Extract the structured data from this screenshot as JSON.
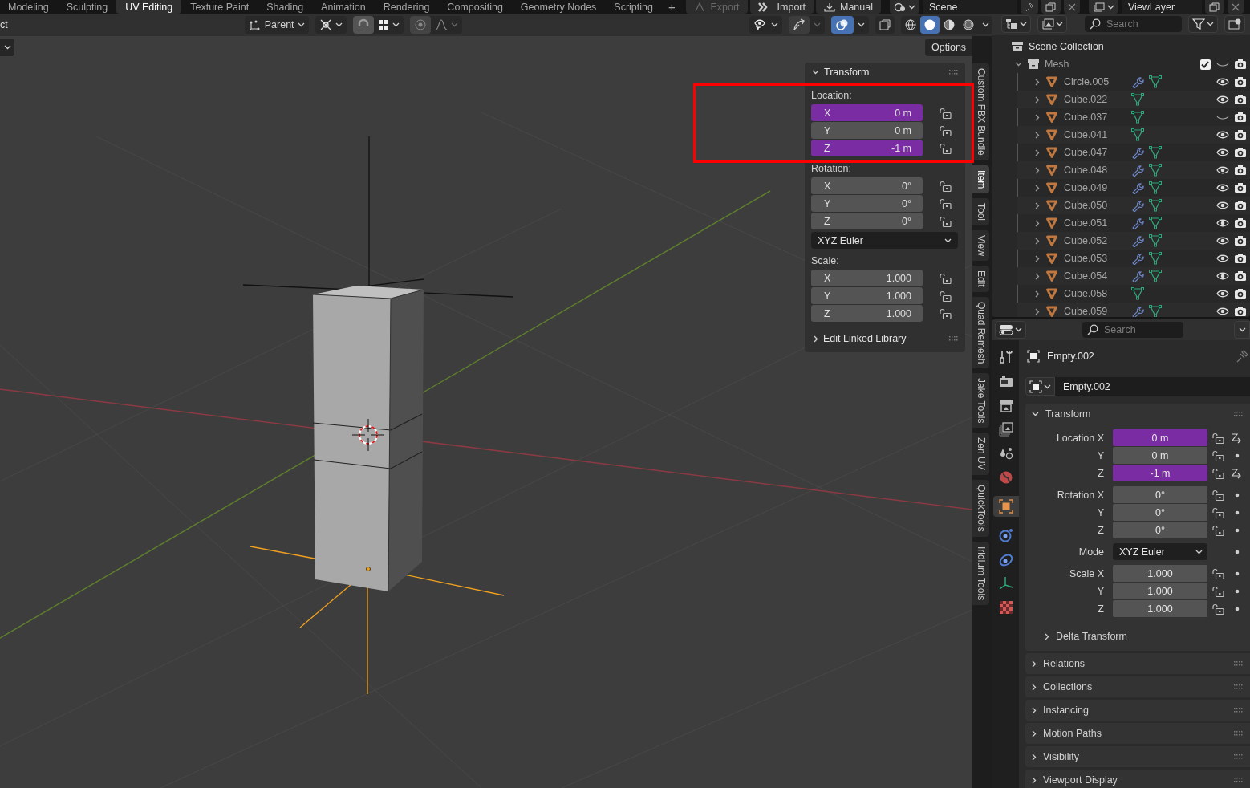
{
  "workspace_tabs": [
    {
      "label": "Modeling",
      "selected": false
    },
    {
      "label": "Sculpting",
      "selected": false
    },
    {
      "label": "UV Editing",
      "selected": true
    },
    {
      "label": "Texture Paint",
      "selected": false
    },
    {
      "label": "Shading",
      "selected": false
    },
    {
      "label": "Animation",
      "selected": false
    },
    {
      "label": "Rendering",
      "selected": false
    },
    {
      "label": "Compositing",
      "selected": false
    },
    {
      "label": "Geometry Nodes",
      "selected": false
    },
    {
      "label": "Scripting",
      "selected": false
    }
  ],
  "add_workspace": "+",
  "top_buttons": [
    {
      "label": "Export",
      "disabled": true
    },
    {
      "label": "Import",
      "disabled": false
    },
    {
      "label": "Manual",
      "disabled": false
    }
  ],
  "scene": "Scene",
  "view_layer": "ViewLayer",
  "viewport": {
    "mode_text": "ct",
    "pivot": "Parent",
    "options": "Options",
    "overlays_on": true,
    "shading_modes": [
      {
        "kind": "wireframe",
        "selected": false
      },
      {
        "kind": "solid",
        "selected": true
      },
      {
        "kind": "material",
        "selected": false
      },
      {
        "kind": "rendered",
        "selected": false
      }
    ]
  },
  "n_panel": {
    "title": "Transform",
    "location_label": "Location:",
    "location": [
      {
        "axis": "X",
        "value": "0 m",
        "keyed": true
      },
      {
        "axis": "Y",
        "value": "0 m",
        "keyed": false
      },
      {
        "axis": "Z",
        "value": "-1 m",
        "keyed": true
      }
    ],
    "rotation_label": "Rotation:",
    "rotation": [
      {
        "axis": "X",
        "value": "0°",
        "keyed": false
      },
      {
        "axis": "Y",
        "value": "0°",
        "keyed": false
      },
      {
        "axis": "Z",
        "value": "0°",
        "keyed": false
      }
    ],
    "rotation_mode": "XYZ Euler",
    "scale_label": "Scale:",
    "scale": [
      {
        "axis": "X",
        "value": "1.000",
        "keyed": false
      },
      {
        "axis": "Y",
        "value": "1.000",
        "keyed": false
      },
      {
        "axis": "Z",
        "value": "1.000",
        "keyed": false
      }
    ],
    "linked_library": "Edit Linked Library"
  },
  "sidebar_tabs": [
    {
      "label": "Custom FBX Bundle",
      "selected": false
    },
    {
      "label": "Item",
      "selected": true
    },
    {
      "label": "Tool",
      "selected": false
    },
    {
      "label": "View",
      "selected": false
    },
    {
      "label": "Edit",
      "selected": false
    },
    {
      "label": "Quad Remesh",
      "selected": false
    },
    {
      "label": "Jake Tools",
      "selected": false
    },
    {
      "label": "Zen UV",
      "selected": false
    },
    {
      "label": "QuickTools",
      "selected": false
    },
    {
      "label": "Iridium Tools",
      "selected": false
    }
  ],
  "outliner": {
    "search_placeholder": "Search",
    "root": "Scene Collection",
    "collections": [
      {
        "name": "Mesh",
        "expanded": true,
        "enabled": true,
        "visible": false,
        "children": [
          {
            "name": "Circle.005",
            "modifier": true,
            "visible": true
          },
          {
            "name": "Cube.022",
            "modifier": false,
            "visible": true
          },
          {
            "name": "Cube.037",
            "modifier": false,
            "visible": false
          },
          {
            "name": "Cube.041",
            "modifier": false,
            "visible": true
          },
          {
            "name": "Cube.047",
            "modifier": true,
            "visible": true
          },
          {
            "name": "Cube.048",
            "modifier": true,
            "visible": true
          },
          {
            "name": "Cube.049",
            "modifier": true,
            "visible": true
          },
          {
            "name": "Cube.050",
            "modifier": true,
            "visible": true
          },
          {
            "name": "Cube.051",
            "modifier": true,
            "visible": true
          },
          {
            "name": "Cube.052",
            "modifier": true,
            "visible": true
          },
          {
            "name": "Cube.053",
            "modifier": true,
            "visible": true
          },
          {
            "name": "Cube.054",
            "modifier": true,
            "visible": true
          },
          {
            "name": "Cube.058",
            "modifier": false,
            "visible": true
          },
          {
            "name": "Cube.059",
            "modifier": true,
            "visible": true
          }
        ]
      }
    ]
  },
  "properties": {
    "search_placeholder": "Search",
    "tabs": [
      {
        "kind": "tool",
        "selected": false
      },
      {
        "kind": "render",
        "selected": false
      },
      {
        "kind": "output",
        "selected": false
      },
      {
        "kind": "view_layer",
        "selected": false
      },
      {
        "kind": "scene",
        "selected": false
      },
      {
        "kind": "world",
        "selected": false
      },
      {
        "kind": "object",
        "selected": true
      },
      {
        "kind": "physics",
        "selected": false
      },
      {
        "kind": "constraints",
        "selected": false
      },
      {
        "kind": "data",
        "selected": false
      },
      {
        "kind": "texture",
        "selected": false
      }
    ],
    "object_name": "Empty.002",
    "datablock": "Empty.002",
    "transform": {
      "title": "Transform",
      "groups": [
        [
          {
            "kind": "number",
            "label": "Location X",
            "value": "0 m",
            "keyed": true
          },
          {
            "kind": "number",
            "label": "Y",
            "value": "0 m",
            "keyed": false
          },
          {
            "kind": "number",
            "label": "Z",
            "value": "-1 m",
            "keyed": true
          }
        ],
        [
          {
            "kind": "number",
            "label": "Rotation X",
            "value": "0°",
            "keyed": false
          },
          {
            "kind": "number",
            "label": "Y",
            "value": "0°",
            "keyed": false
          },
          {
            "kind": "number",
            "label": "Z",
            "value": "0°",
            "keyed": false
          }
        ],
        [
          {
            "kind": "dropdown",
            "label": "Mode",
            "value": "XYZ Euler"
          }
        ],
        [
          {
            "kind": "number",
            "label": "Scale X",
            "value": "1.000",
            "keyed": false
          },
          {
            "kind": "number",
            "label": "Y",
            "value": "1.000",
            "keyed": false
          },
          {
            "kind": "number",
            "label": "Z",
            "value": "1.000",
            "keyed": false
          }
        ]
      ],
      "subpanel": "Delta Transform"
    },
    "panels": [
      "Relations",
      "Collections",
      "Instancing",
      "Motion Paths",
      "Visibility",
      "Viewport Display"
    ]
  }
}
